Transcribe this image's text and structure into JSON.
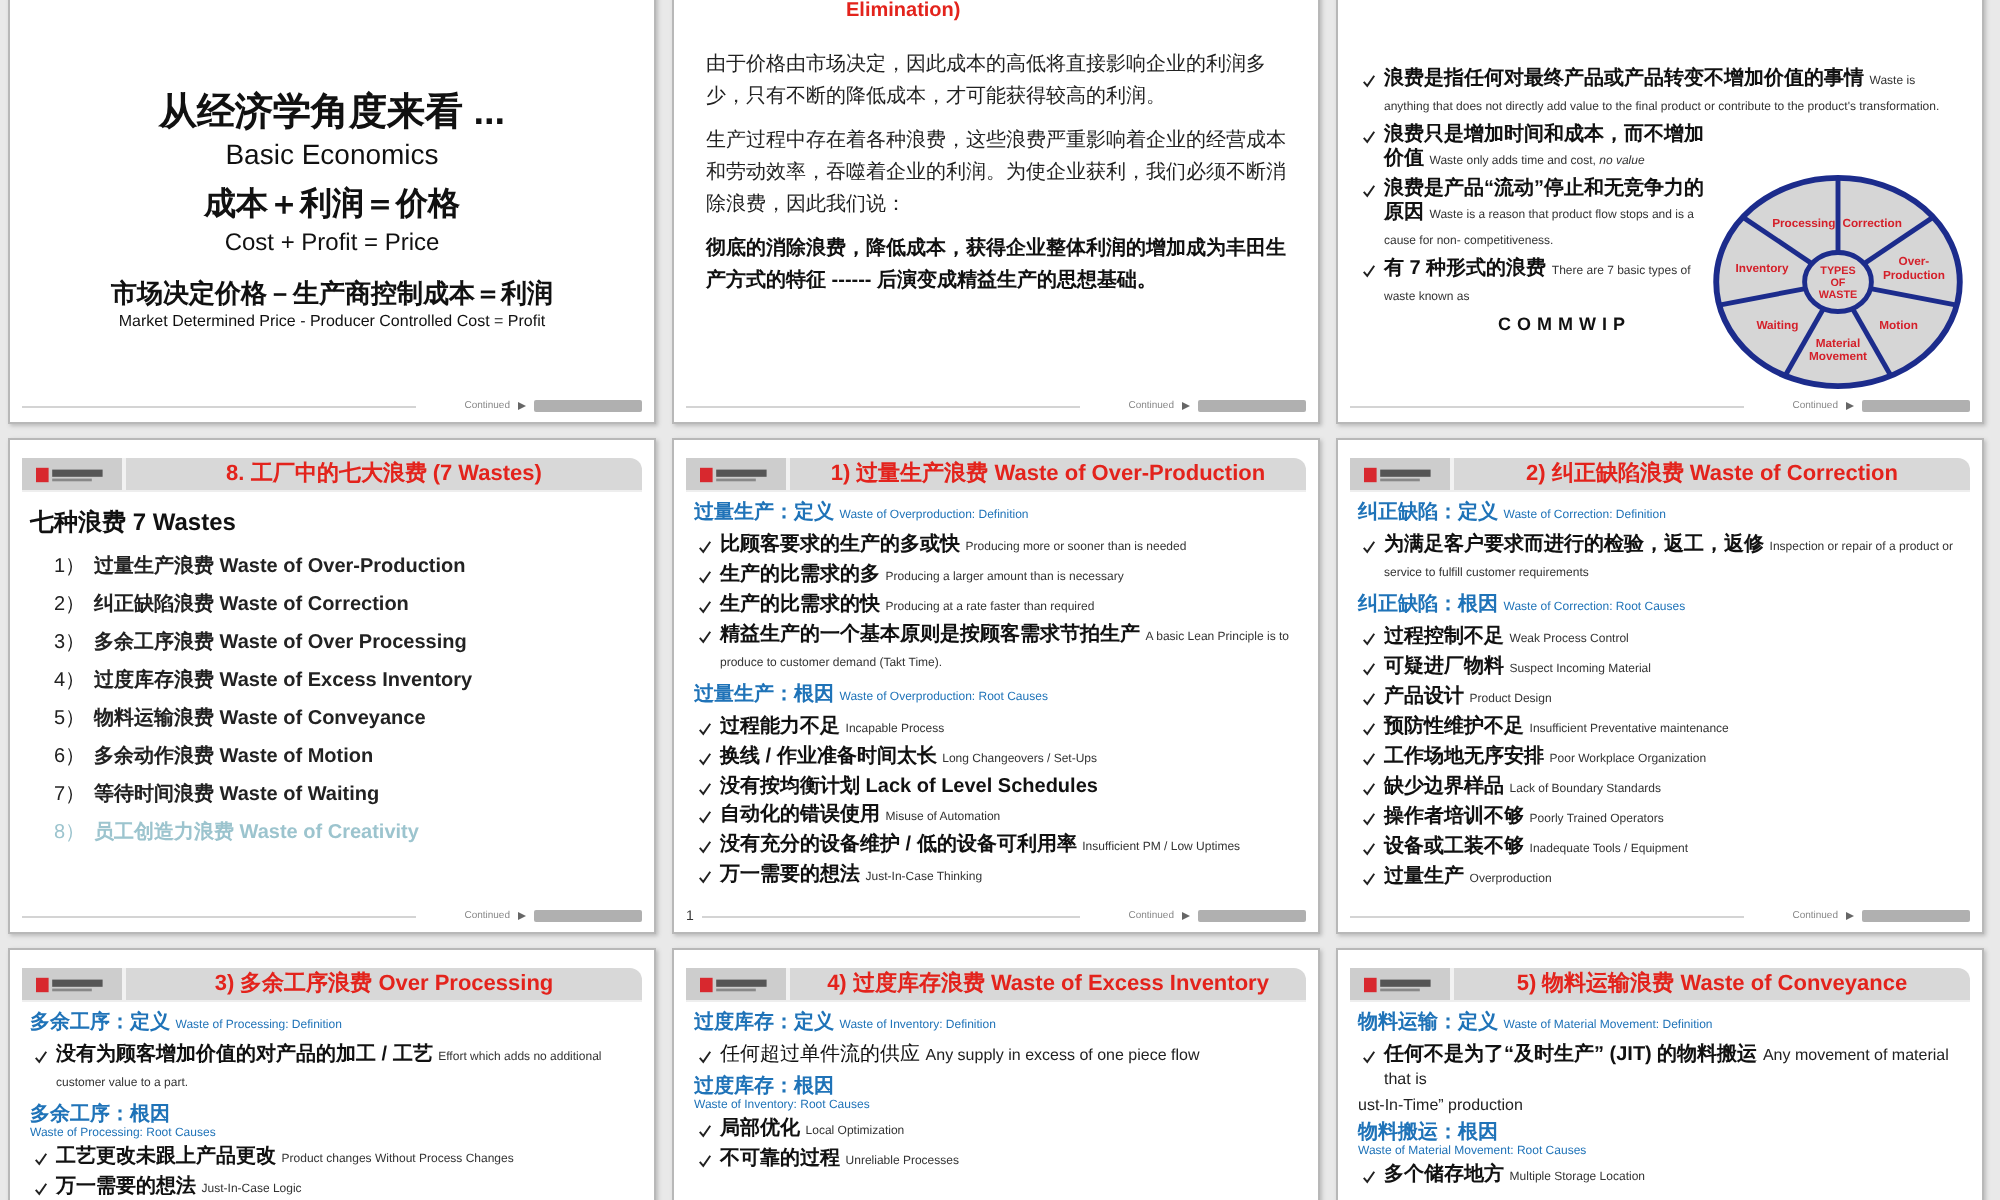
{
  "slides": [
    {
      "kind": "title",
      "lines": [
        {
          "text": "从经济学角度来看 ...",
          "kind": "headline"
        },
        {
          "text": "Basic Economics",
          "kind": "subtitle"
        },
        {
          "text": "成本＋利润＝价格",
          "kind": "equation"
        },
        {
          "text": "Cost + Profit = Price",
          "kind": "translation"
        },
        {
          "text": "市场决定价格－生产商控制成本＝利润",
          "kind": "statement"
        },
        {
          "text": "Market Determined Price - Producer Controlled Cost = Profit",
          "kind": "caption"
        }
      ],
      "footer": "Continued"
    },
    {
      "kind": "text",
      "title": "Elimination)",
      "paragraphs": [
        {
          "text": "由于价格由市场决定，因此成本的高低将直接影响企业的利润多少，只有不断的降低成本，才可能获得较高的利润。",
          "bold": false
        },
        {
          "text": "生产过程中存在着各种浪费，这些浪费严重影响着企业的经营成本和劳动效率，吞噬着企业的利润。为使企业获利，我们必须不断消除浪费，因此我们说：",
          "bold": false
        },
        {
          "text": "彻底的消除浪费，降低成本，获得企业整体利润的增加成为丰田生产方式的特征 ------ 后演变成精益生产的思想基础。",
          "bold": true
        }
      ],
      "footer": "Continued"
    },
    {
      "kind": "diagram",
      "bullets": [
        {
          "cn": "浪费是指任何对最终产品或产品转变不增加价值的事情",
          "en": "Waste is anything that does not directly add value to the final product or contribute to the product's transformation."
        },
        {
          "cn": "浪费只是增加时间和成本，而不增加价值",
          "en": "Waste only adds time and cost, *no value*"
        },
        {
          "cn": "浪费是产品“流动”停止和无竞争力的原因",
          "en": "Waste is a reason that product flow stops and is a cause for non- competitiveness."
        },
        {
          "cn": "有 7 种形式的浪费",
          "en": "There are 7 basic types of waste known as"
        }
      ],
      "note": "COMMWIP",
      "wheel": {
        "center": [
          "TYPES",
          "OF",
          "WASTE"
        ],
        "segments": [
          {
            "lines": [
              "Processing"
            ]
          },
          {
            "lines": [
              "Correction"
            ]
          },
          {
            "lines": [
              "Inventory"
            ]
          },
          {
            "lines": [
              "Over-",
              "Production"
            ]
          },
          {
            "lines": [
              "Waiting"
            ]
          },
          {
            "lines": [
              "Motion"
            ]
          },
          {
            "lines": [
              "Material",
              "Movement"
            ]
          }
        ]
      },
      "footer": "Continued"
    },
    {
      "kind": "list",
      "header": "8.  工厂中的七大浪费 (7 Wastes)",
      "heading": "七种浪费 7  Wastes",
      "items": [
        {
          "num": "1）",
          "text": "过量生产浪费 Waste of Over-Production",
          "faded": false
        },
        {
          "num": "2）",
          "text": "纠正缺陷浪费 Waste of Correction",
          "faded": false
        },
        {
          "num": "3）",
          "text": "多余工序浪费 Waste of Over Processing",
          "faded": false
        },
        {
          "num": "4）",
          "text": "过度库存浪费 Waste of Excess Inventory",
          "faded": false
        },
        {
          "num": "5）",
          "text": "物料运输浪费 Waste of Conveyance",
          "faded": false
        },
        {
          "num": "6）",
          "text": "多余动作浪费 Waste of Motion",
          "faded": false
        },
        {
          "num": "7）",
          "text": "等待时间浪费 Waste of Waiting",
          "faded": false
        },
        {
          "num": "8）",
          "text": "员工创造力浪费 Waste of Creativity",
          "faded": true
        }
      ],
      "footer": "Continued"
    },
    {
      "kind": "blocks",
      "header": "1) 过量生产浪费 Waste of Over-Production",
      "blocks": [
        {
          "kind": "heading",
          "cn": "过量生产：定义",
          "en": "Waste of Overproduction: Definition"
        },
        {
          "kind": "bullet",
          "cn": "比顾客要求的生产的多或快",
          "en": "Producing more or sooner than is needed"
        },
        {
          "kind": "bullet",
          "cn": "生产的比需求的多",
          "en": "Producing a larger amount than is necessary"
        },
        {
          "kind": "bullet",
          "cn": "生产的比需求的快",
          "en": "Producing at a rate faster than required"
        },
        {
          "kind": "bullet",
          "cn": "精益生产的一个基本原则是按顾客需求节拍生产",
          "en": "A basic Lean Principle is to produce to customer demand (Takt Time)."
        },
        {
          "kind": "heading",
          "cn": "过量生产：根因",
          "en": "Waste of Overproduction: Root Causes"
        },
        {
          "kind": "bullet",
          "cn": "过程能力不足",
          "en": "Incapable Process"
        },
        {
          "kind": "bullet",
          "cn": "换线 / 作业准备时间太长",
          "en": "Long Changeovers / Set-Ups"
        },
        {
          "kind": "bullet-strong",
          "cn": "没有按均衡计划",
          "en": "Lack of Level Schedules"
        },
        {
          "kind": "bullet",
          "cn": "自动化的错误使用",
          "en": "Misuse of Automation"
        },
        {
          "kind": "bullet",
          "cn": "没有充分的设备维护 / 低的设备可利用率",
          "en": "Insufficient PM / Low Uptimes"
        },
        {
          "kind": "bullet",
          "cn": "万一需要的想法",
          "en": "Just-In-Case Thinking"
        }
      ],
      "footer_note": "1",
      "footer": "Continued"
    },
    {
      "kind": "blocks",
      "header": "2) 纠正缺陷浪费 Waste of Correction",
      "blocks": [
        {
          "kind": "heading",
          "cn": "纠正缺陷：定义",
          "en": "Waste of Correction: Definition"
        },
        {
          "kind": "bullet",
          "cn": "为满足客户要求而进行的检验，返工，返修",
          "en": "Inspection or repair of a product or service to fulfill customer requirements"
        },
        {
          "kind": "heading",
          "cn": "纠正缺陷：根因",
          "en": "Waste of Correction: Root Causes"
        },
        {
          "kind": "bullet",
          "cn": "过程控制不足",
          "en": "Weak Process Control"
        },
        {
          "kind": "bullet",
          "cn": "可疑进厂物料",
          "en": "Suspect Incoming Material"
        },
        {
          "kind": "bullet",
          "cn": "产品设计",
          "en": "Product Design"
        },
        {
          "kind": "bullet",
          "cn": "预防性维护不足",
          "en": "Insufficient Preventative maintenance"
        },
        {
          "kind": "bullet",
          "cn": "工作场地无序安排",
          "en": "Poor Workplace Organization"
        },
        {
          "kind": "bullet",
          "cn": "缺少边界样品",
          "en": "Lack of Boundary Standards"
        },
        {
          "kind": "bullet",
          "cn": "操作者培训不够",
          "en": "Poorly Trained Operators"
        },
        {
          "kind": "bullet",
          "cn": "设备或工装不够",
          "en": "Inadequate Tools / Equipment"
        },
        {
          "kind": "bullet",
          "cn": "过量生产",
          "en": "Overproduction"
        }
      ],
      "footer": "Continued"
    },
    {
      "kind": "blocks",
      "header": "3)  多余工序浪费 Over Processing",
      "blocks": [
        {
          "kind": "heading",
          "cn": "多余工序：定义",
          "en": "Waste of Processing:  Definition"
        },
        {
          "kind": "bullet",
          "cn": "没有为顾客增加价值的对产品的加工 / 工艺",
          "en": "Effort which adds no additional customer value to a part."
        },
        {
          "kind": "heading-stacked",
          "cn": "多余工序：根因",
          "en": "Waste of Processing:  Root Causes"
        },
        {
          "kind": "bullet",
          "cn": "工艺更改未跟上产品更改",
          "en": "Product changes Without Process Changes"
        },
        {
          "kind": "bullet",
          "cn": "万一需要的想法",
          "en": "Just-In-Case Logic"
        }
      ]
    },
    {
      "kind": "blocks",
      "header": "4) 过度库存浪费 Waste of Excess Inventory",
      "blocks": [
        {
          "kind": "heading",
          "cn": "过度库存：定义",
          "en": "Waste of Inventory:  Definition"
        },
        {
          "kind": "bullet-plain",
          "cn": "任何超过单件流的供应",
          "en": "Any supply in excess of one piece flow"
        },
        {
          "kind": "heading-stacked",
          "cn": "过度库存：根因",
          "en": "Waste of Inventory: Root Causes"
        },
        {
          "kind": "bullet",
          "cn": "局部优化",
          "en": "Local Optimization"
        },
        {
          "kind": "bullet",
          "cn": "不可靠的过程",
          "en": "Unreliable Processes"
        }
      ]
    },
    {
      "kind": "blocks",
      "header": "5) 物料运输浪费 Waste of Conveyance",
      "blocks": [
        {
          "kind": "heading",
          "cn": "物料运输：定义",
          "en": "Waste of Material Movement: Definition"
        },
        {
          "kind": "bullet-large",
          "cn": "任何不是为了“及时生产” (JIT) 的物料搬运",
          "en": "Any movement of material that is"
        },
        {
          "kind": "note",
          "text": "ust-In-Time” production"
        },
        {
          "kind": "heading-stacked",
          "cn": "物料搬运：根因",
          "en": "Waste of Material Movement: Root Causes"
        },
        {
          "kind": "bullet",
          "cn": "多个储存地方",
          "en": "Multiple Storage Location"
        }
      ]
    }
  ]
}
